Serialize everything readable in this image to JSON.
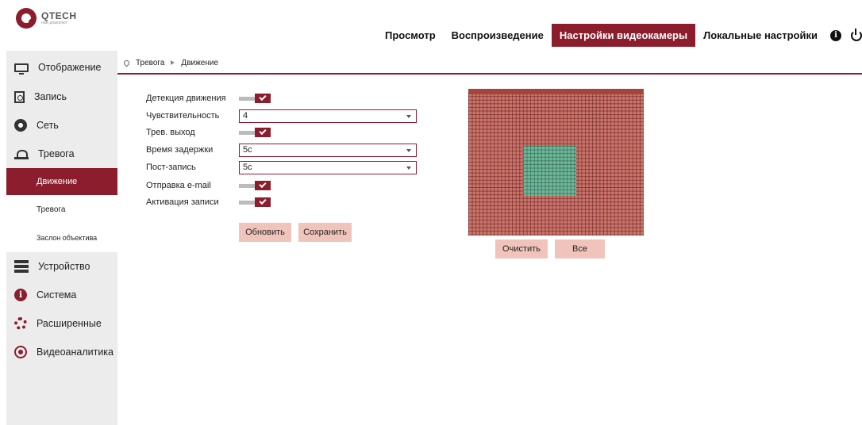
{
  "brand": {
    "name": "QTECH",
    "tagline": "нам доверяют"
  },
  "nav": {
    "items": [
      {
        "label": "Просмотр",
        "active": false
      },
      {
        "label": "Воспроизведение",
        "active": false
      },
      {
        "label": "Настройки видеокамеры",
        "active": true
      },
      {
        "label": "Локальные настройки",
        "active": false
      }
    ],
    "info_icon": "info-icon",
    "info_glyph": "i",
    "power_icon": "power-icon"
  },
  "sidebar": {
    "items": [
      {
        "label": "Отображение",
        "icon": "monitor-icon"
      },
      {
        "label": "Запись",
        "icon": "record-icon"
      },
      {
        "label": "Сеть",
        "icon": "network-icon"
      },
      {
        "label": "Тревога",
        "icon": "alarm-icon"
      },
      {
        "label": "Устройство",
        "icon": "device-icon"
      },
      {
        "label": "Система",
        "icon": "info-icon"
      },
      {
        "label": "Расширенные",
        "icon": "gear-icon"
      },
      {
        "label": "Видеоаналитика",
        "icon": "analytics-icon"
      }
    ],
    "system_glyph": "i",
    "submenu": [
      {
        "label": "Движение",
        "active": true
      },
      {
        "label": "Тревога",
        "active": false
      },
      {
        "label": "Заслон объектива",
        "active": false
      }
    ]
  },
  "breadcrumb": {
    "parent": "Тревога",
    "current": "Движение"
  },
  "form": {
    "motion_detection": {
      "label": "Детекция движения",
      "enabled": true
    },
    "sensitivity": {
      "label": "Чувствительность",
      "value": "4"
    },
    "alarm_output": {
      "label": "Трев. выход",
      "enabled": true
    },
    "delay_time": {
      "label": "Время задержки",
      "value": "5с"
    },
    "post_record": {
      "label": "Пост-запись",
      "value": "5с"
    },
    "email": {
      "label": "Отправка e-mail",
      "enabled": true
    },
    "record_activation": {
      "label": "Активация записи",
      "enabled": true
    },
    "refresh_label": "Обновить",
    "save_label": "Сохранить"
  },
  "motion_area": {
    "clear_label": "Очистить",
    "all_label": "Все"
  },
  "colors": {
    "accent": "#8b1d2c",
    "button": "#f0c4ba",
    "grid": "#c9756b",
    "selection": "#6fb79a"
  }
}
